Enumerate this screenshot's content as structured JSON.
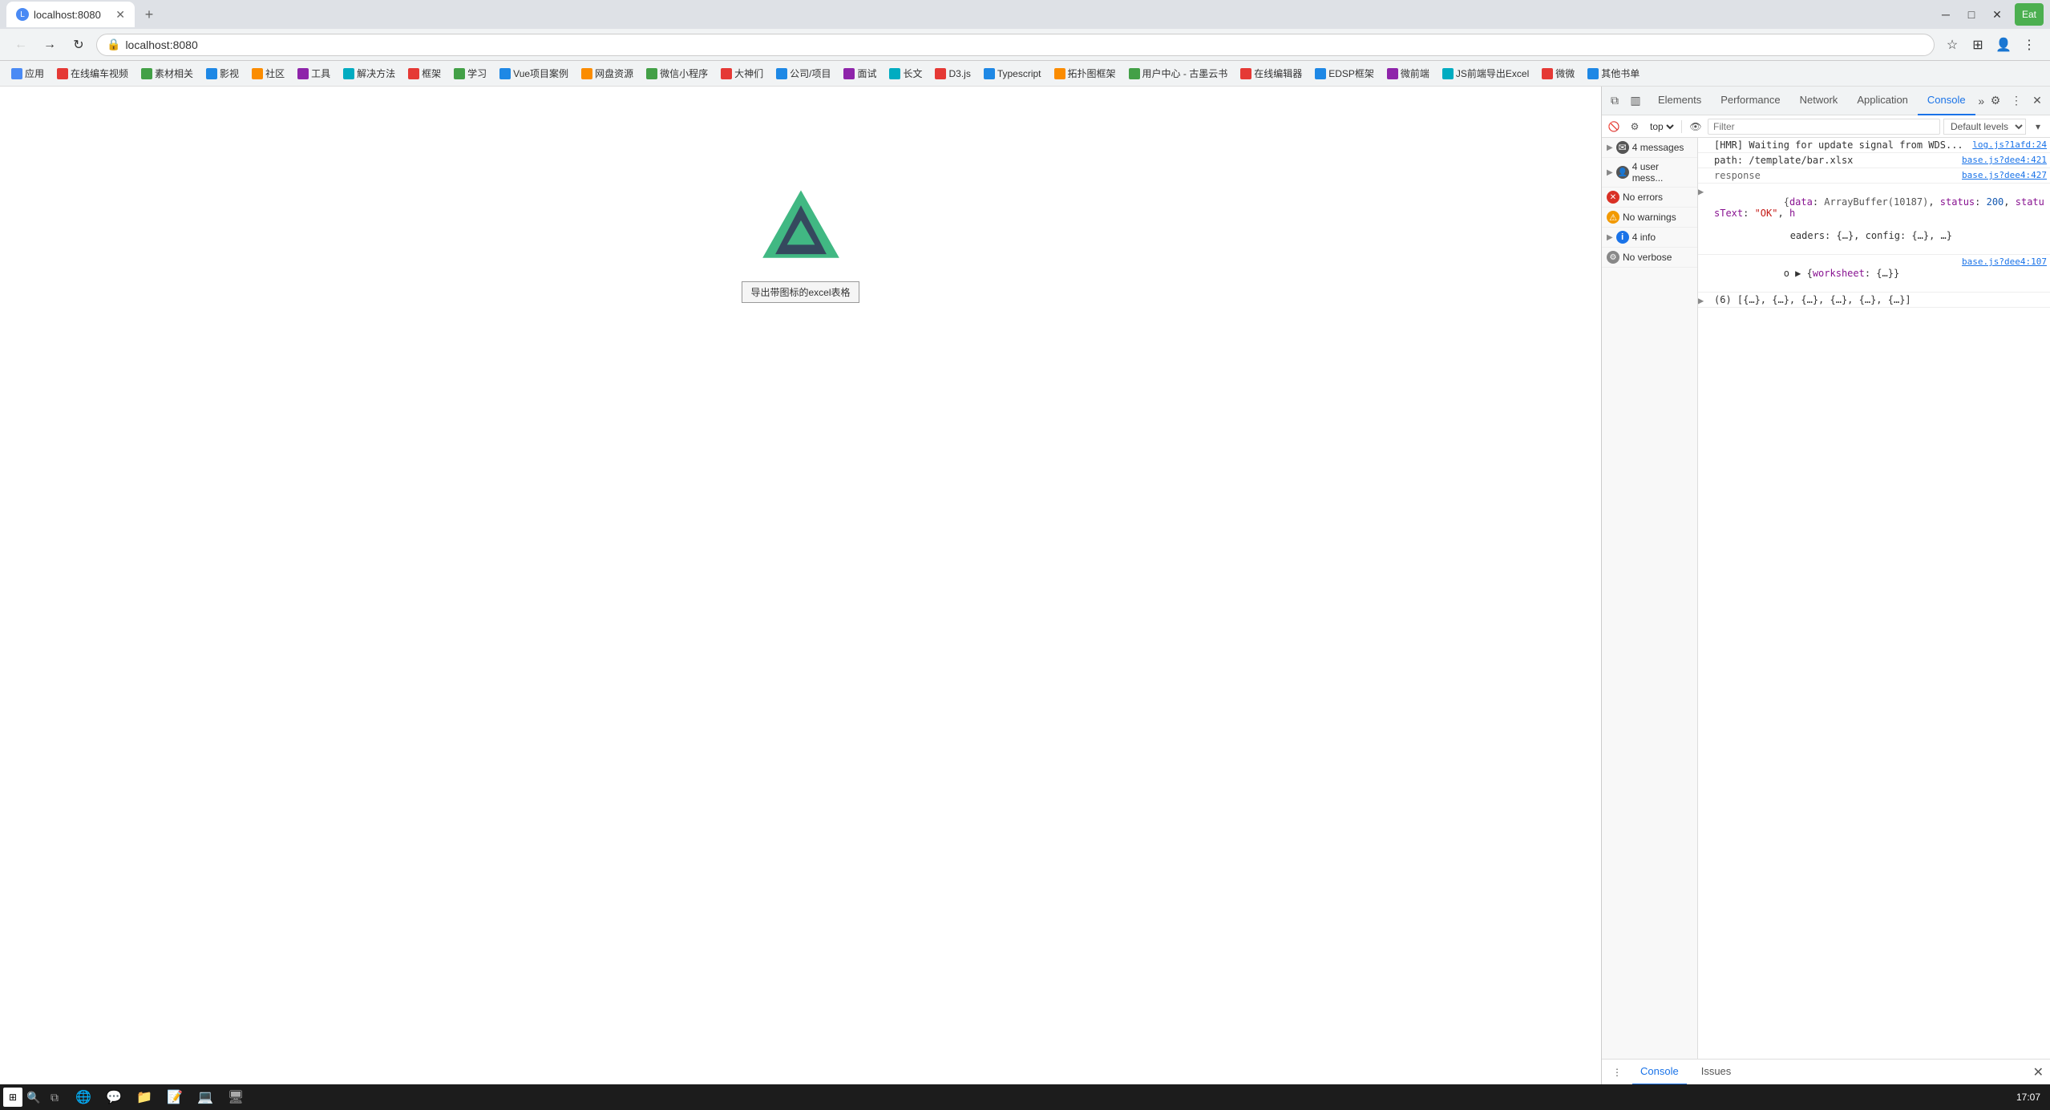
{
  "browser": {
    "tab": {
      "title": "localhost:8080",
      "favicon": "L"
    },
    "address": "localhost:8080",
    "bookmarks": [
      {
        "label": "应用",
        "color": "#4a8af4"
      },
      {
        "label": "在线编车视频",
        "color": "#e53935"
      },
      {
        "label": "素材相关",
        "color": "#43a047"
      },
      {
        "label": "影视",
        "color": "#1e88e5"
      },
      {
        "label": "社区",
        "color": "#fb8c00"
      },
      {
        "label": "工具",
        "color": "#8e24aa"
      },
      {
        "label": "解决方法",
        "color": "#00acc1"
      },
      {
        "label": "框架",
        "color": "#e53935"
      },
      {
        "label": "学习",
        "color": "#43a047"
      },
      {
        "label": "Vue项目案例",
        "color": "#1e88e5"
      },
      {
        "label": "网盘资源",
        "color": "#fb8c00"
      },
      {
        "label": "微信小程序",
        "color": "#43a047"
      },
      {
        "label": "大神们",
        "color": "#e53935"
      },
      {
        "label": "公司/项目",
        "color": "#1e88e5"
      },
      {
        "label": "面试",
        "color": "#8e24aa"
      },
      {
        "label": "长文",
        "color": "#00acc1"
      },
      {
        "label": "D3.js",
        "color": "#e53935"
      },
      {
        "label": "Typescript",
        "color": "#1e88e5"
      },
      {
        "label": "拓扑图框架",
        "color": "#fb8c00"
      },
      {
        "label": "用户中心 - 古墨云书",
        "color": "#43a047"
      },
      {
        "label": "在线编辑器",
        "color": "#e53935"
      },
      {
        "label": "EDSP框架",
        "color": "#1e88e5"
      },
      {
        "label": "微前端",
        "color": "#8e24aa"
      },
      {
        "label": "JS前端导出Excel",
        "color": "#00acc1"
      },
      {
        "label": "微微",
        "color": "#e53935"
      },
      {
        "label": "其他书单",
        "color": "#1e88e5"
      }
    ]
  },
  "page": {
    "button_label": "导出带图标的excel表格"
  },
  "devtools": {
    "tabs": [
      {
        "label": "Elements",
        "active": false
      },
      {
        "label": "Performance",
        "active": false
      },
      {
        "label": "Network",
        "active": false
      },
      {
        "label": "Application",
        "active": false
      },
      {
        "label": "Console",
        "active": true
      }
    ],
    "toolbar": {
      "context": "top",
      "filter_placeholder": "Filter",
      "level": "Default levels"
    },
    "sidebar_groups": [
      {
        "label": "4 messages",
        "count": "",
        "icon": "msg",
        "expandable": true
      },
      {
        "label": "4 user mess...",
        "count": "",
        "icon": "user",
        "expandable": true
      },
      {
        "label": "No errors",
        "count": "",
        "icon": "error",
        "expandable": false
      },
      {
        "label": "No warnings",
        "count": "",
        "icon": "warn",
        "expandable": false
      },
      {
        "label": "4 info",
        "count": "",
        "icon": "info",
        "expandable": true
      },
      {
        "label": "No verbose",
        "count": "",
        "icon": "verbose",
        "expandable": false
      }
    ],
    "log_entries": [
      {
        "id": 1,
        "expandable": false,
        "content": "[HMR] Waiting for update signal from WDS...",
        "source": "log.js?1afd:24",
        "type": "normal"
      },
      {
        "id": 2,
        "expandable": false,
        "content": "path: /template/bar.xlsx",
        "source": "base.js?dee4:421",
        "type": "normal"
      },
      {
        "id": 3,
        "expandable": false,
        "content": "response",
        "source": "base.js?dee4:427",
        "type": "label"
      },
      {
        "id": 4,
        "expandable": true,
        "content": "{data: ArrayBuffer(10187), status: 200, statusText: \"OK\", headers: {…}, config: {…}, …}",
        "source": "",
        "type": "obj",
        "expanded": false
      },
      {
        "id": 5,
        "expandable": false,
        "content": "o ▶ {worksheet: {…}}",
        "source": "base.js?dee4:107",
        "type": "normal"
      },
      {
        "id": 6,
        "expandable": true,
        "content": "(6) [{…}, {…}, {…}, {…}, {…}, {…}]",
        "source": "",
        "type": "arr",
        "expanded": false
      }
    ],
    "bottom_tabs": [
      {
        "label": "Console",
        "active": true
      },
      {
        "label": "Issues",
        "active": false
      }
    ]
  },
  "taskbar": {
    "time": "17:07"
  },
  "icons": {
    "back": "←",
    "forward": "→",
    "refresh": "↻",
    "home": "⌂",
    "lock": "🔒",
    "star": "☆",
    "more": "⋮",
    "settings": "⚙",
    "close": "✕",
    "expand": "▶",
    "collapse": "▼",
    "arrow_right": "▶",
    "info": "i",
    "error": "✕",
    "warn": "⚠",
    "verbose": "…"
  }
}
